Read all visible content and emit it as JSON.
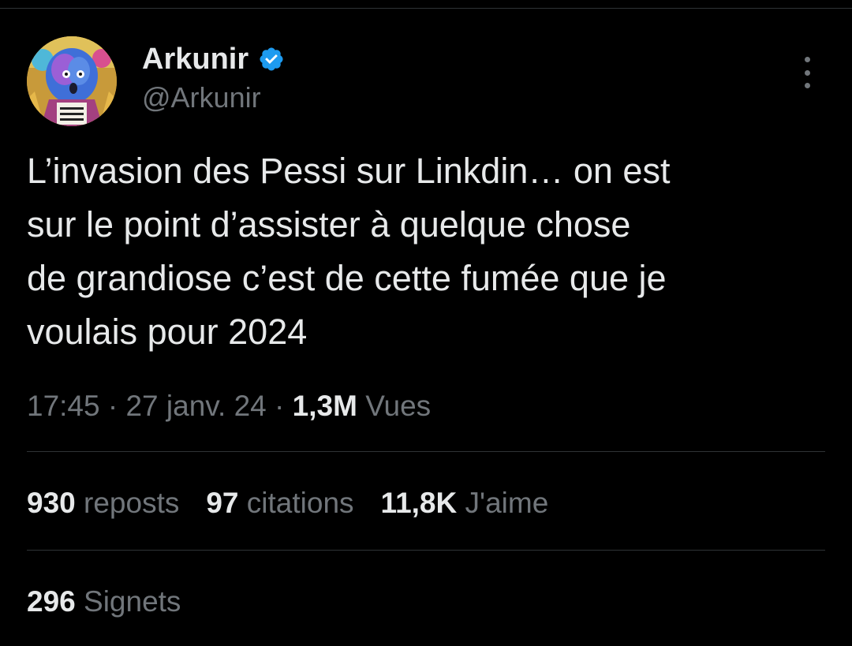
{
  "author": {
    "display_name": "Arkunir",
    "handle": "@Arkunir",
    "verified": true,
    "avatar": "anime-character-avatar"
  },
  "tweet": {
    "text": "L’invasion des Pessi sur Linkdin… on est\nsur le point d’assister à quelque chose\nde grandiose c’est de cette fumée que je\nvoulais pour 2024",
    "time": "17:45",
    "separator": "·",
    "date": "27 janv. 24",
    "views_count": "1,3M",
    "views_label": "Vues"
  },
  "stats": {
    "reposts_count": "930",
    "reposts_label": "reposts",
    "quotes_count": "97",
    "quotes_label": "citations",
    "likes_count": "11,8K",
    "likes_label": "J'aime",
    "bookmarks_count": "296",
    "bookmarks_label": "Signets"
  },
  "icons": {
    "verified": "verified-badge-icon",
    "more": "more-options-icon"
  },
  "colors": {
    "background": "#000000",
    "primary_text": "#e7e9ea",
    "secondary_text": "#71767b",
    "divider": "#2f3336",
    "verified_blue": "#1d9bf0"
  }
}
